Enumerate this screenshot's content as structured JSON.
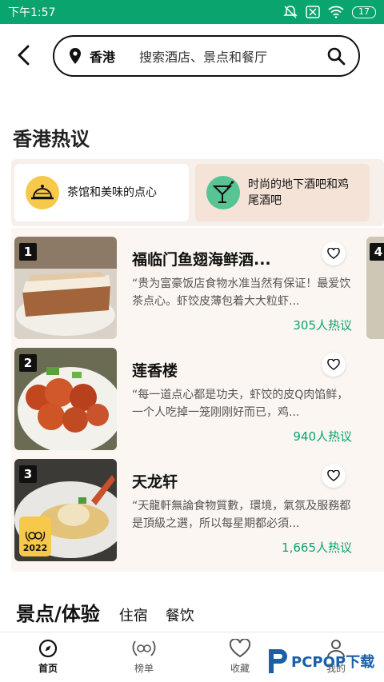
{
  "status_bar": {
    "time": "下午1:57",
    "battery": "17"
  },
  "header": {
    "city": "香港",
    "search_placeholder": "搜索酒店、景点和餐厅"
  },
  "section": {
    "title": "香港热议"
  },
  "themes": [
    {
      "label": "茶馆和美味的点心",
      "icon": "bell-dish-icon",
      "color": "#f6c94b",
      "selected": true
    },
    {
      "label": "时尚的地下酒吧和鸡尾酒吧",
      "icon": "cocktail-icon",
      "color": "#57c494",
      "selected": false
    }
  ],
  "restaurants": [
    {
      "rank": "1",
      "name": "福临门鱼翅海鲜酒...",
      "quote": "“贵为富豪饭店食物水准当然有保证！最爱饮茶点心。虾饺皮薄包着大大粒虾...",
      "count": "305人热议"
    },
    {
      "rank": "2",
      "name": "莲香楼",
      "quote": "“每一道点心都是功夫，虾饺的皮Q肉馅鲜，一个人吃掉一笼刚刚好而已，鸡...",
      "count": "940人热议"
    },
    {
      "rank": "3",
      "name": "天龙轩",
      "quote": "“天龍軒無論食物質數，環境，氣氛及服務都是頂級之選，所以每星期都必須...",
      "count": "1,665人热议",
      "award": "2022"
    }
  ],
  "peek_rank": "4",
  "category_tabs": {
    "main": "景点/体验",
    "sub1": "住宿",
    "sub2": "餐饮"
  },
  "bottom_nav": [
    {
      "label": "首页",
      "icon": "compass-icon",
      "active": true
    },
    {
      "label": "榜单",
      "icon": "laurel-icon",
      "active": false
    },
    {
      "label": "收藏",
      "icon": "heart-icon",
      "active": false
    },
    {
      "label": "我的",
      "icon": "person-icon",
      "active": false
    }
  ],
  "watermark": {
    "text": "PCPOP下载"
  },
  "colors": {
    "brand": "#0aa46f",
    "accent_yellow": "#f6c94b",
    "accent_green": "#57c494"
  }
}
